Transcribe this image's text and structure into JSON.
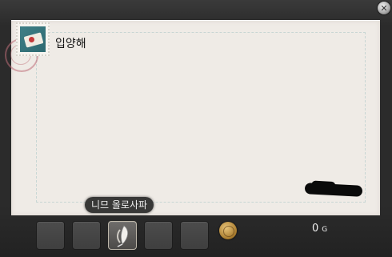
{
  "window": {
    "close_glyph": "✕",
    "close_icon": "close-icon"
  },
  "letter": {
    "recipient": "입양해",
    "stamp_icon": "stamp-icon",
    "postmark_icon": "postmark-icon",
    "signature": "handwritten-signature-redacted"
  },
  "attachments": {
    "sender_label": "니므 올로사파",
    "slots": [
      {
        "icon": "empty-slot"
      },
      {
        "icon": "empty-slot"
      },
      {
        "icon": "feather-icon"
      },
      {
        "icon": "empty-slot"
      },
      {
        "icon": "empty-slot"
      }
    ]
  },
  "currency": {
    "icon": "coin-icon",
    "amount": "0",
    "unit": "G"
  },
  "colors": {
    "paper": "#efebe6",
    "frame": "#2b2b2b",
    "border_dash": "#c8d6d4"
  }
}
